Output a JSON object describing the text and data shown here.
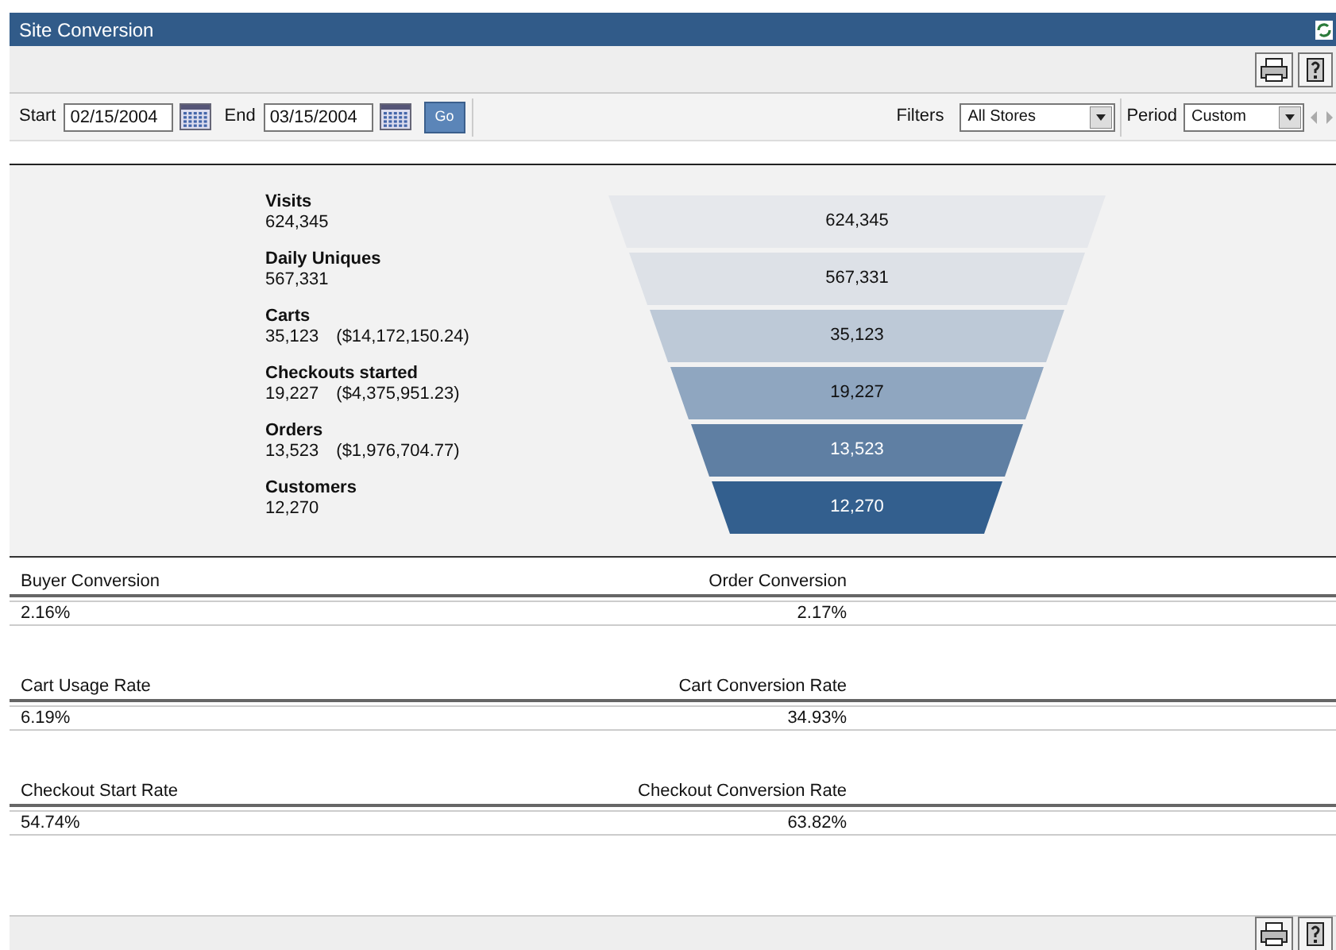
{
  "window": {
    "title": "Site Conversion"
  },
  "date_range": {
    "start_label": "Start",
    "start_value": "02/15/2004",
    "end_label": "End",
    "end_value": "03/15/2004",
    "go_button": "Go"
  },
  "filters": {
    "label": "Filters",
    "value": "All Stores"
  },
  "period": {
    "label": "Period",
    "value": "Custom"
  },
  "funnel": [
    {
      "name": "Visits",
      "count": "624,345",
      "segment_label": "624,345",
      "color": "#e6e8ec"
    },
    {
      "name": "Daily Uniques",
      "count": "567,331",
      "segment_label": "567,331",
      "color": "#dde1e7"
    },
    {
      "name": "Carts",
      "count": "35,123",
      "amount": "($14,172,150.24)",
      "segment_label": "35,123",
      "color": "#bdc9d7"
    },
    {
      "name": "Checkouts started",
      "count": "19,227",
      "amount": "($4,375,951.23)",
      "segment_label": "19,227",
      "color": "#8fa6c0"
    },
    {
      "name": "Orders",
      "count": "13,523",
      "amount": "($1,976,704.77)",
      "segment_label": "13,523",
      "color": "#5f7fa3"
    },
    {
      "name": "Customers",
      "count": "12,270",
      "segment_label": "12,270",
      "color": "#335f8e"
    }
  ],
  "metrics": [
    {
      "left_label": "Buyer Conversion",
      "left_value": "2.16%",
      "right_label": "Order Conversion",
      "right_value": "2.17%"
    },
    {
      "left_label": "Cart Usage Rate",
      "left_value": "6.19%",
      "right_label": "Cart Conversion Rate",
      "right_value": "34.93%"
    },
    {
      "left_label": "Checkout Start Rate",
      "left_value": "54.74%",
      "right_label": "Checkout Conversion Rate",
      "right_value": "63.82%"
    }
  ]
}
